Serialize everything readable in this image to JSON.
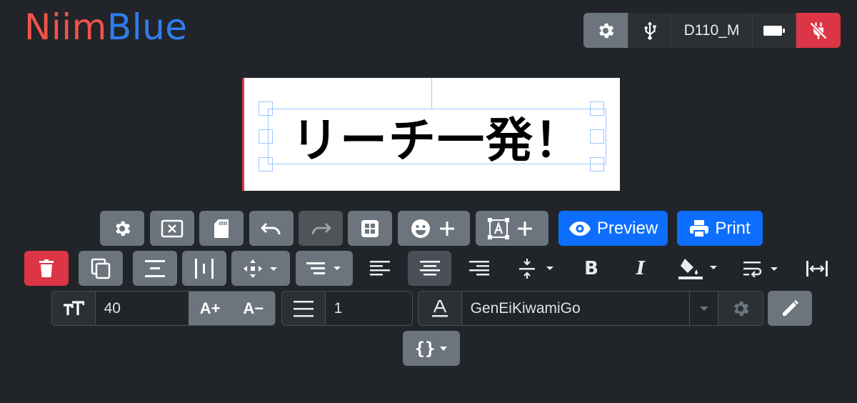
{
  "app": {
    "logo_part1": "Niim",
    "logo_part2": "Blue"
  },
  "topbar": {
    "device_name": "D110_M",
    "icons": [
      "gear-icon",
      "usb-icon",
      "battery-icon",
      "unplug-icon"
    ]
  },
  "canvas": {
    "label_text": "リーチ一発！"
  },
  "toolbar_row1": {
    "icons": [
      "gear-icon",
      "clear-icon",
      "sd-card-icon",
      "undo-icon",
      "redo-icon",
      "grid-icon",
      "emoji-add-icon",
      "text-add-icon"
    ],
    "preview_label": "Preview",
    "print_label": "Print"
  },
  "toolbar_row2": {
    "icons": [
      "trash-icon",
      "copy-icon",
      "align-center-vertical-icon",
      "align-center-horizontal-icon",
      "move-icon",
      "text-align-dropdown-icon",
      "align-left-icon",
      "align-center-icon",
      "align-right-icon",
      "vertical-spacing-icon",
      "bold-icon",
      "italic-icon",
      "fill-icon",
      "wrap-icon",
      "fit-width-icon"
    ]
  },
  "font_controls": {
    "font_size": "40",
    "increase_label": "A+",
    "decrease_label": "A−",
    "line_height": "1",
    "font_family": "GenEiKiwamiGo"
  },
  "variables_label": "{}",
  "colors": {
    "background": "#212529",
    "primary": "#0d6efd",
    "danger": "#dc3545",
    "secondary": "#6c757d",
    "logo_red": "#f0524a",
    "logo_blue": "#2f7df0"
  }
}
